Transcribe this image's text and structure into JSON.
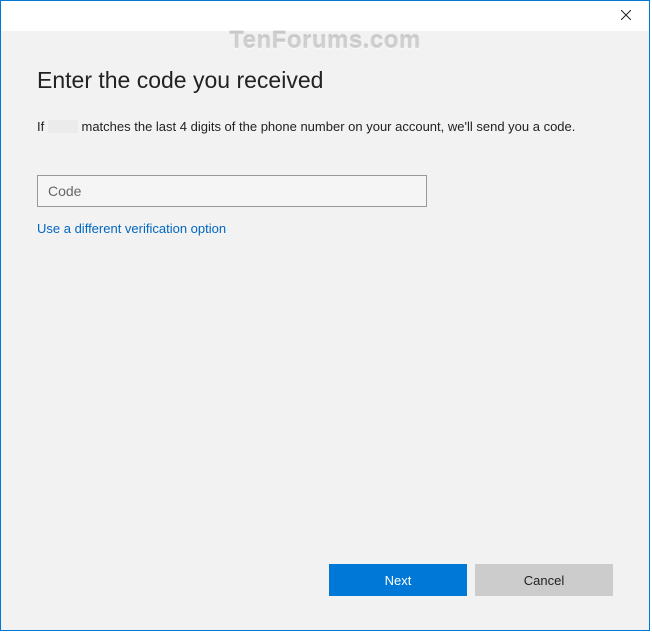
{
  "watermark": "TenForums.com",
  "header": {
    "title": "Enter the code you received"
  },
  "body": {
    "description_prefix": "If",
    "description_suffix": "matches the last 4 digits of the phone number on your account, we'll send you a code.",
    "code_placeholder": "Code",
    "code_value": "",
    "alt_link": "Use a different verification option"
  },
  "footer": {
    "primary_label": "Next",
    "secondary_label": "Cancel"
  }
}
